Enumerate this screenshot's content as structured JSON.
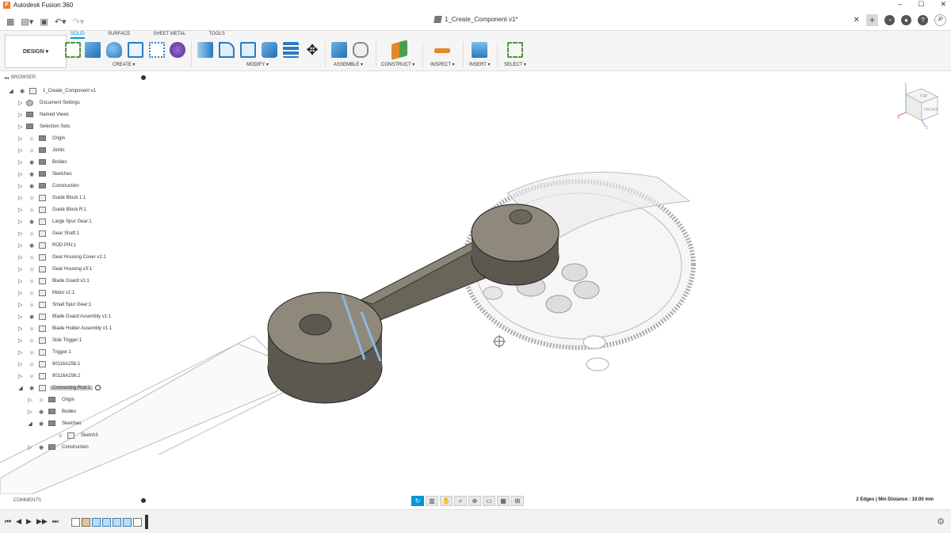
{
  "window": {
    "app_title": "Autodesk Fusion 360",
    "document_tab": "1_Create_Component v1*",
    "controls": [
      "–",
      "☐",
      "✕"
    ],
    "user_initials": "JP"
  },
  "ribbon": {
    "workspace": "DESIGN ▾",
    "tabs": [
      "SOLID",
      "SURFACE",
      "SHEET METAL",
      "TOOLS"
    ],
    "active_tab": "SOLID",
    "groups": {
      "create": "CREATE ▾",
      "modify": "MODIFY ▾",
      "assemble": "ASSEMBLE ▾",
      "construct": "CONSTRUCT ▾",
      "inspect": "INSPECT ▾",
      "insert": "INSERT ▾",
      "select": "SELECT ▾"
    }
  },
  "browser": {
    "title": "BROWSER",
    "root": "1_Create_Component v1",
    "items": [
      {
        "label": "Document Settings",
        "icon": "gear-icon"
      },
      {
        "label": "Named Views",
        "icon": "folder-icon"
      },
      {
        "label": "Selection Sets",
        "icon": "folder-icon"
      },
      {
        "label": "Origin",
        "icon": "folder-icon"
      },
      {
        "label": "Joints",
        "icon": "folder-icon"
      },
      {
        "label": "Bodies",
        "icon": "folder-icon"
      },
      {
        "label": "Sketches",
        "icon": "folder-icon"
      },
      {
        "label": "Construction",
        "icon": "folder-icon"
      },
      {
        "label": "Guide Block 1:1",
        "icon": "component-icon"
      },
      {
        "label": "Guide Block R:1",
        "icon": "component-icon"
      },
      {
        "label": "Large Spur Gear:1",
        "icon": "component-icon"
      },
      {
        "label": "Gear Shaft:1",
        "icon": "component-icon"
      },
      {
        "label": "ROD PIN:1",
        "icon": "component-icon"
      },
      {
        "label": "Gear Housing Cover v1:1",
        "icon": "component-icon"
      },
      {
        "label": "Gear Housing v3:1",
        "icon": "component-icon"
      },
      {
        "label": "Blade Guard v1:1",
        "icon": "component-icon"
      },
      {
        "label": "Motor v1:1",
        "icon": "component-icon"
      },
      {
        "label": "Small Spur Gear:1",
        "icon": "component-icon"
      },
      {
        "label": "Blade Guard Assembly v1:1",
        "icon": "component-icon"
      },
      {
        "label": "Blade Holder Assembly v1:1",
        "icon": "component-icon"
      },
      {
        "label": "Side Trigger:1",
        "icon": "component-icon"
      },
      {
        "label": "Trigger:1",
        "icon": "component-icon"
      },
      {
        "label": "90116A256:1",
        "icon": "component-icon"
      },
      {
        "label": "90116A256:2",
        "icon": "component-icon"
      },
      {
        "label": "Connecting Rod:1",
        "icon": "component-icon"
      }
    ],
    "connecting_rod_children": [
      {
        "label": "Origin"
      },
      {
        "label": "Bodies"
      },
      {
        "label": "Sketches"
      },
      {
        "label": "Sketch3"
      },
      {
        "label": "Construction"
      }
    ]
  },
  "comments": {
    "title": "COMMENTS"
  },
  "status": {
    "measure": "2 Edges | Min Distance : 10.00 mm"
  },
  "viewcube": {
    "top": "TOP",
    "front": "FRONT",
    "axis_x": "X",
    "axis_y": "Y",
    "axis_z": "Z"
  }
}
